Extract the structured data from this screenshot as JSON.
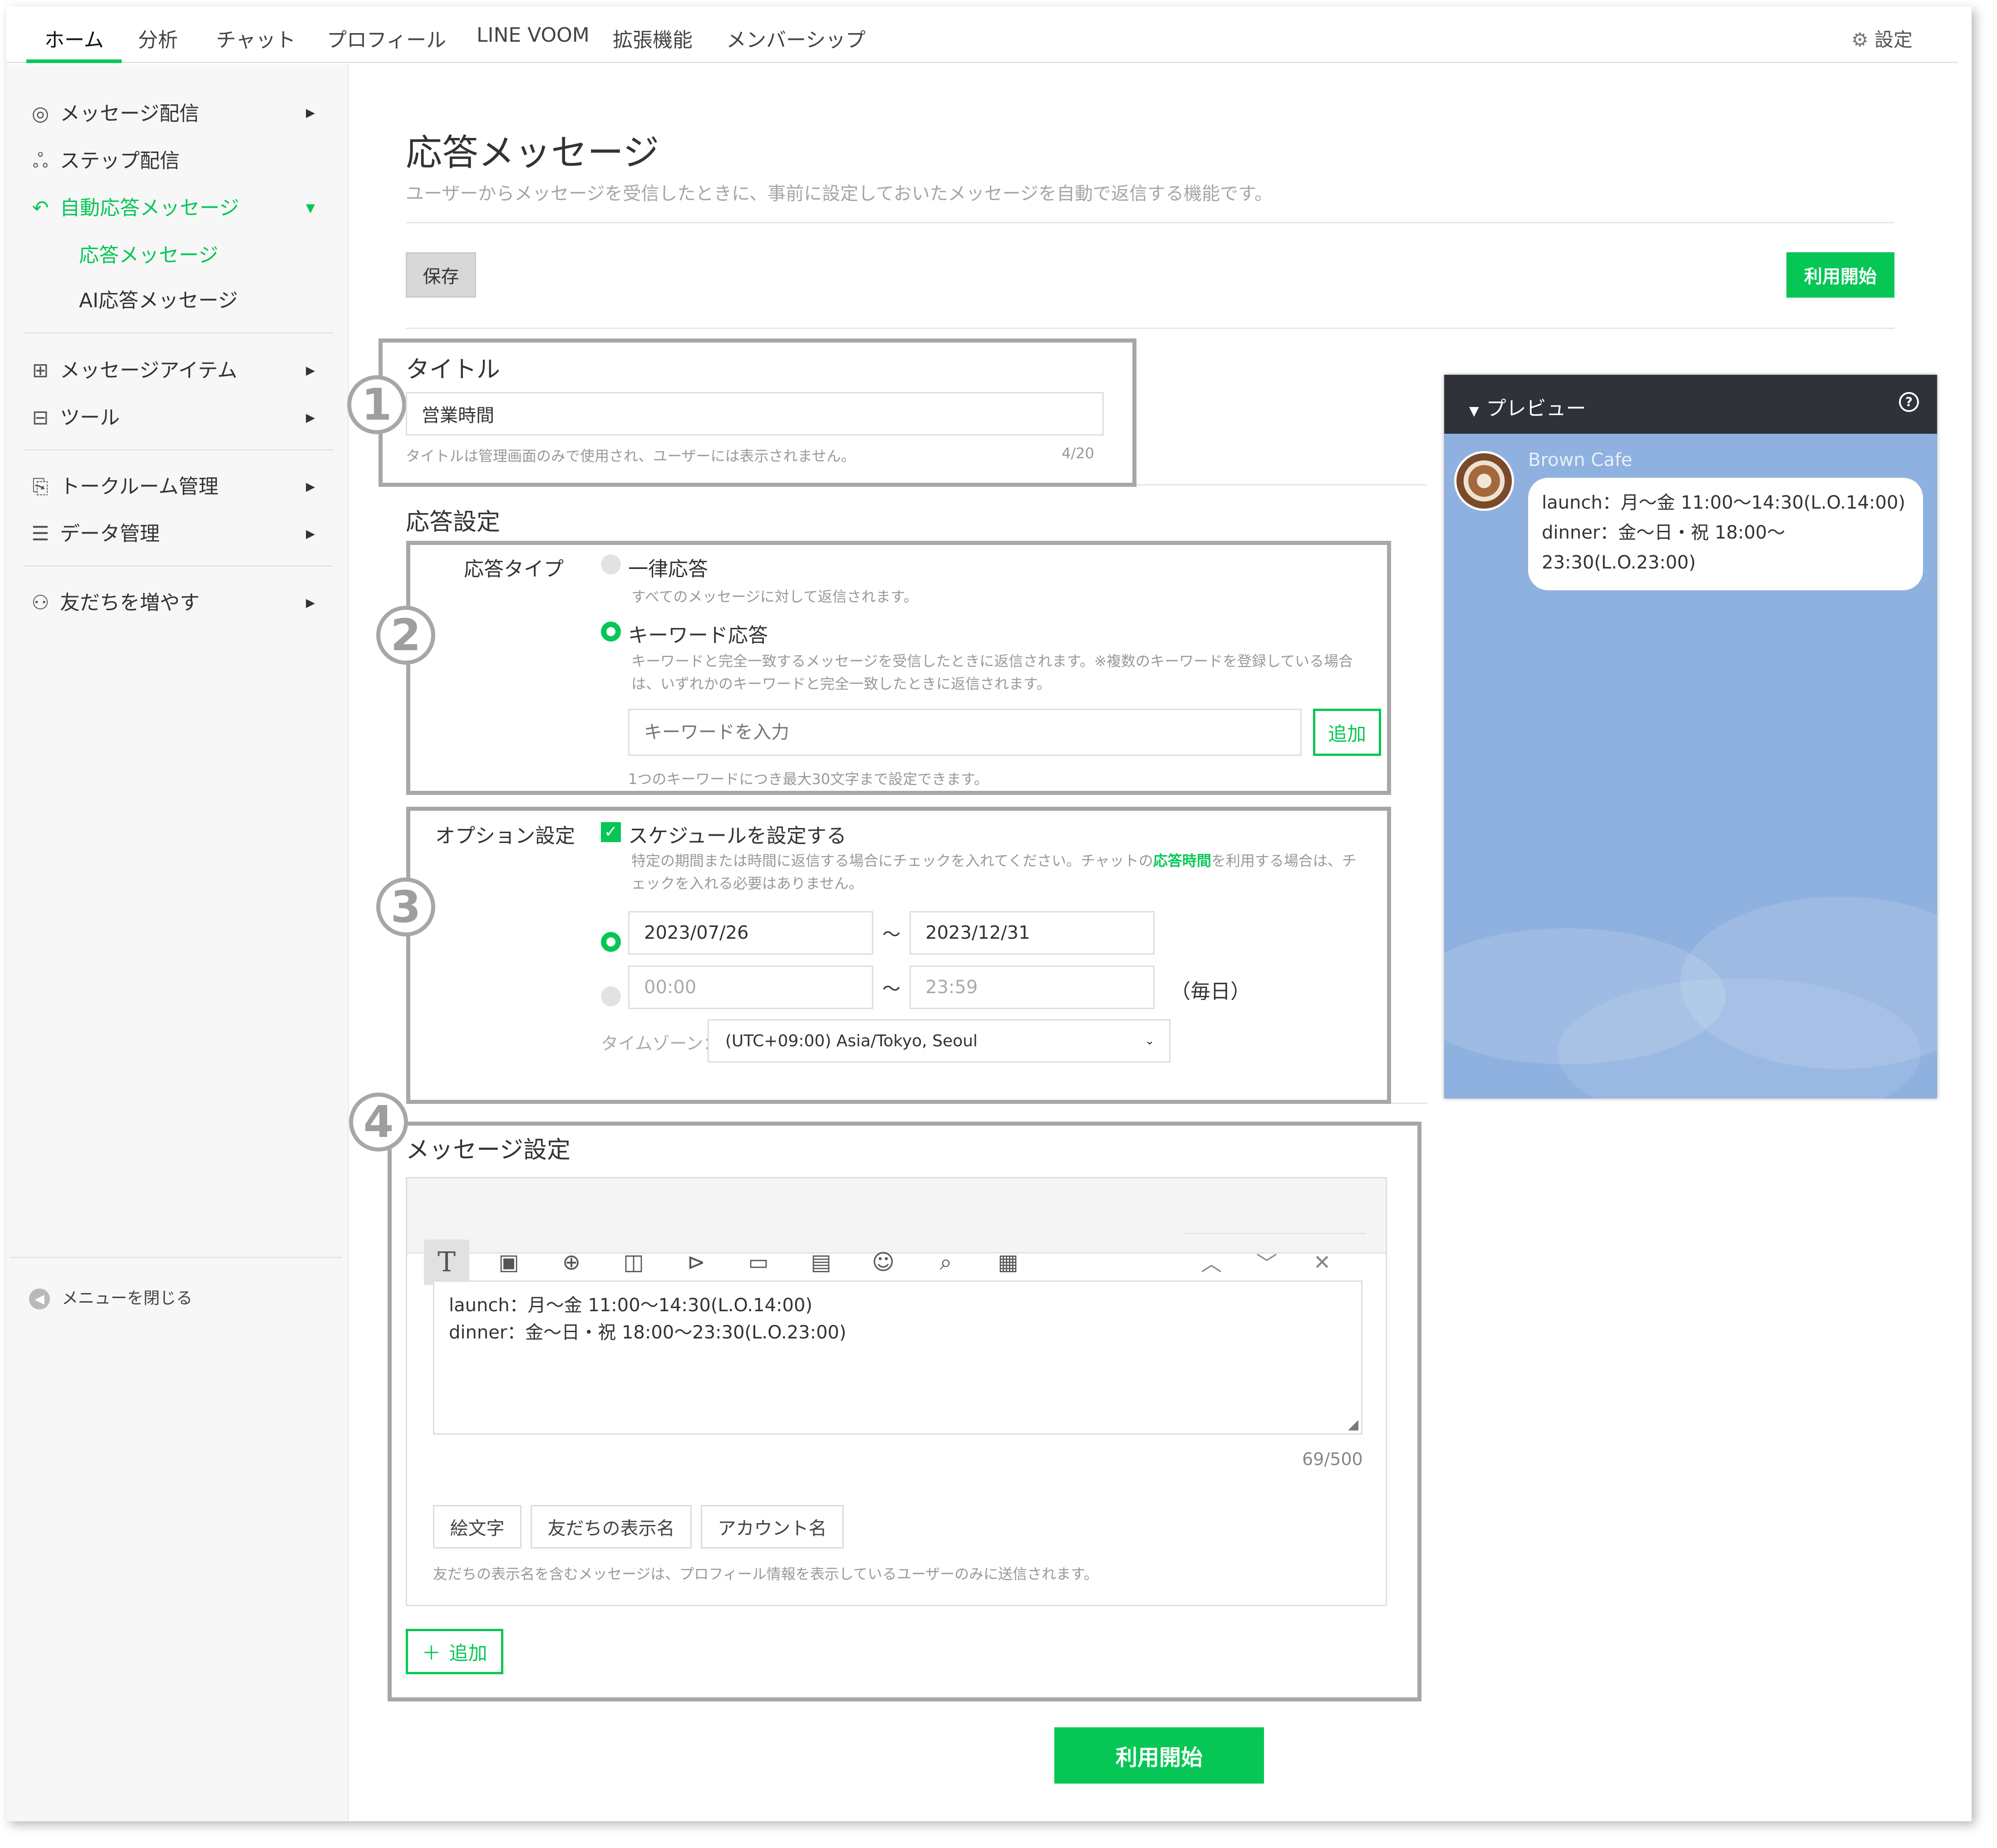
{
  "nav": {
    "tabs": [
      "ホーム",
      "分析",
      "チャット",
      "プロフィール",
      "LINE VOOM",
      "拡張機能",
      "メンバーシップ"
    ],
    "settings": "設定"
  },
  "sidebar": {
    "items": [
      {
        "label": "メッセージ配信",
        "icon": "broadcast-icon"
      },
      {
        "label": "ステップ配信",
        "icon": "step-icon"
      },
      {
        "label": "自動応答メッセージ",
        "icon": "auto-reply-icon"
      },
      {
        "label": "応答メッセージ"
      },
      {
        "label": "AI応答メッセージ"
      },
      {
        "label": "メッセージアイテム",
        "icon": "message-item-icon"
      },
      {
        "label": "ツール",
        "icon": "tool-icon"
      },
      {
        "label": "トークルーム管理",
        "icon": "chatroom-icon"
      },
      {
        "label": "データ管理",
        "icon": "database-icon"
      },
      {
        "label": "友だちを増やす",
        "icon": "add-friend-icon"
      }
    ],
    "close_menu": "メニューを閉じる"
  },
  "page": {
    "title": "応答メッセージ",
    "description": "ユーザーからメッセージを受信したときに、事前に設定しておいたメッセージを自動で返信する機能です。",
    "save": "保存",
    "start": "利用開始"
  },
  "annotations": [
    "1",
    "2",
    "3",
    "4"
  ],
  "title_section": {
    "label": "タイトル",
    "value": "営業時間",
    "hint": "タイトルは管理画面のみで使用され、ユーザーには表示されません。",
    "count": "4/20"
  },
  "response": {
    "heading": "応答設定",
    "type_label": "応答タイプ",
    "opt1": "一律応答",
    "opt1_desc": "すべてのメッセージに対して返信されます。",
    "opt2": "キーワード応答",
    "opt2_desc1": "キーワードと完全一致するメッセージを受信したときに返信されます。※複数のキーワードを登録している場合",
    "opt2_desc2": "は、いずれかのキーワードと完全一致したときに返信されます。",
    "keyword_placeholder": "キーワードを入力",
    "add": "追加",
    "keyword_hint": "1つのキーワードにつき最大30文字まで設定できます。"
  },
  "options": {
    "label": "オプション設定",
    "schedule": "スケジュールを設定する",
    "desc_pre": "特定の期間または時間に返信する場合にチェックを入れてください。チャットの",
    "desc_link": "応答時間",
    "desc_post": "を利用する場合は、チ",
    "desc2": "ェックを入れる必要はありません。",
    "date_from": "2023/07/26",
    "date_to": "2023/12/31",
    "tilde": "～",
    "time_from": "00:00",
    "time_to": "23:59",
    "daily": "（毎日）",
    "tz_label": "タイムゾーン：",
    "tz_value": "(UTC+09:00) Asia/Tokyo, Seoul"
  },
  "message": {
    "heading": "メッセージ設定",
    "line1": "launch：月～金 11:00～14:30(L.O.14:00)",
    "line2": "dinner：金～日・祝 18:00～23:30(L.O.23:00)",
    "count": "69/500",
    "chips": [
      "絵文字",
      "友だちの表示名",
      "アカウント名"
    ],
    "hint": "友だちの表示名を含むメッセージは、プロフィール情報を表示しているユーザーのみに送信されます。",
    "add": "追加"
  },
  "preview": {
    "header": "プレビュー",
    "account": "Brown Cafe",
    "bubble": [
      "launch：月～金 11:00～14:30(L.O.14:00)",
      "dinner：金～日・祝 18:00～",
      "23:30(L.O.23:00)"
    ]
  },
  "colors": {
    "accent": "#06c755",
    "annotation": "#a7a7a7",
    "preview_bg": "#8fb1df",
    "preview_header": "#2f3238"
  }
}
